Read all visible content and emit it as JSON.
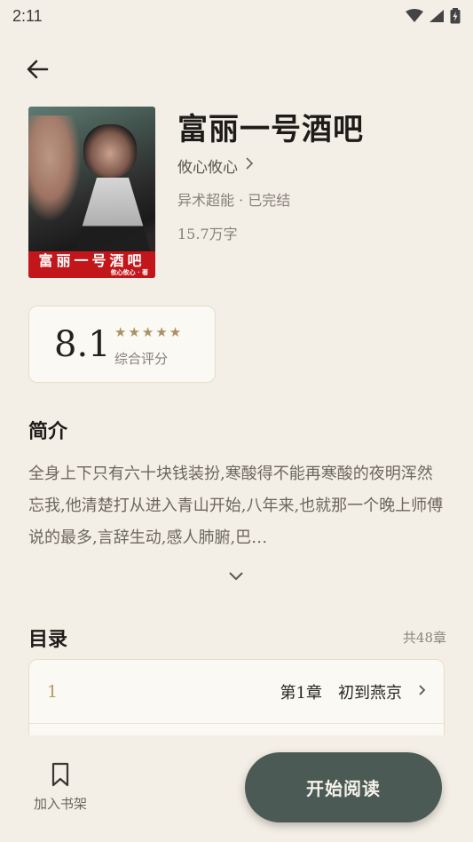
{
  "status_bar": {
    "time": "2:11"
  },
  "book": {
    "title": "富丽一号酒吧",
    "author": "攸心攸心",
    "category_status": "异术超能 · 已完结",
    "word_count": "15.7万字",
    "cover": {
      "title_text": "富丽一号酒吧",
      "author_text": "攸心攸心 · 著"
    }
  },
  "rating": {
    "score": "8.1",
    "stars": 5,
    "label": "综合评分"
  },
  "intro": {
    "heading": "简介",
    "text": "全身上下只有六十块钱装扮,寒酸得不能再寒酸的夜明浑然忘我,他清楚打从进入青山开始,八年来,也就那一个晚上师傅说的最多,言辞生动,感人肺腑,巴…"
  },
  "toc": {
    "heading": "目录",
    "count": "共48章",
    "chapters": [
      {
        "num": "1",
        "name": "第1章　初到燕京"
      }
    ]
  },
  "bottom": {
    "shelf_label": "加入书架",
    "read_label": "开始阅读"
  },
  "colors": {
    "background": "#f4efe6",
    "accent": "#4c5a55",
    "gold": "#b69865"
  }
}
